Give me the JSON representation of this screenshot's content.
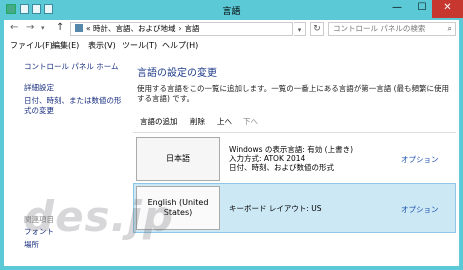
{
  "window": {
    "title": "言語",
    "minimize_glyph": "—",
    "maximize_glyph": "☐",
    "close_glyph": "✕"
  },
  "address": {
    "back_glyph": "←",
    "forward_glyph": "→",
    "recent_glyph": "▾",
    "up_glyph": "↑",
    "lead": "«",
    "crumb1": "時計、言語、および地域",
    "sep": "›",
    "crumb2": "言語",
    "dropdown_glyph": "▾",
    "refresh_glyph": "↻",
    "search_placeholder": "コントロール パネルの検索",
    "search_icon_glyph": "⌕"
  },
  "menu": {
    "file": "ファイル(F)",
    "edit": "編集(E)",
    "view": "表示(V)",
    "tools": "ツール(T)",
    "help": "ヘルプ(H)"
  },
  "sidebar": {
    "home": "コントロール パネル ホーム",
    "advanced": "詳細設定",
    "datetime": "日付、時刻、または数値の形式の変更",
    "related_heading": "関連項目",
    "fonts": "フォント",
    "location": "場所"
  },
  "main": {
    "title": "言語の設定の変更",
    "description": "使用する言語をこの一覧に追加します。一覧の一番上にある言語が第一言語 (最も頻繁に使用する言語) です。",
    "toolbar": {
      "add": "言語の追加",
      "remove": "削除",
      "up": "上へ",
      "down": "下へ"
    },
    "languages": [
      {
        "name": "日本語",
        "line1": "Windows の表示言語: 有効 (上書き)",
        "line2": "入力方式: ATOK 2014",
        "line3": "日付、時刻、および数値の形式",
        "option": "オプション"
      },
      {
        "name": "English (United States)",
        "line1": "キーボード レイアウト: US",
        "option": "オプション"
      }
    ]
  },
  "watermark": "des.jp",
  "colors": {
    "frame": "#5cc9d6",
    "close": "#c7372f",
    "link": "#1a2f80",
    "title": "#1e3a8a",
    "selected_row": "#cce8f4"
  }
}
